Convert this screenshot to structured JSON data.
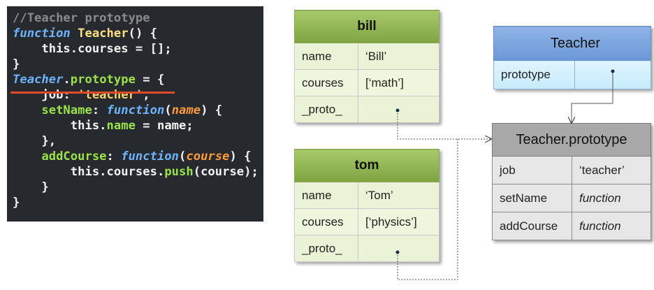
{
  "code": {
    "lines": [
      [
        {
          "t": "//Teacher prototype",
          "c": "cmt"
        }
      ],
      [
        {
          "t": "function",
          "c": "kw"
        },
        {
          "t": " ",
          "c": "plain"
        },
        {
          "t": "Teacher",
          "c": "fn"
        },
        {
          "t": "() {",
          "c": "plain"
        }
      ],
      [
        {
          "t": "    this.",
          "c": "plain"
        },
        {
          "t": "courses",
          "c": "plain"
        },
        {
          "t": " = [];",
          "c": "plain"
        }
      ],
      [
        {
          "t": "}",
          "c": "plain"
        }
      ],
      [
        {
          "t": "Teacher",
          "c": "kw"
        },
        {
          "t": ".",
          "c": "plain"
        },
        {
          "t": "prototype",
          "c": "prop"
        },
        {
          "t": " = {",
          "c": "plain"
        }
      ],
      [
        {
          "t": "    job",
          "c": "plain"
        },
        {
          "t": ": ",
          "c": "plain"
        },
        {
          "t": "'teacher'",
          "c": "str"
        },
        {
          "t": ",",
          "c": "plain"
        }
      ],
      [
        {
          "t": "    setName",
          "c": "prop"
        },
        {
          "t": ": ",
          "c": "plain"
        },
        {
          "t": "function",
          "c": "kw"
        },
        {
          "t": "(",
          "c": "plain"
        },
        {
          "t": "name",
          "c": "param"
        },
        {
          "t": ") {",
          "c": "plain"
        }
      ],
      [
        {
          "t": "        this.",
          "c": "plain"
        },
        {
          "t": "name",
          "c": "prop"
        },
        {
          "t": " = name;",
          "c": "plain"
        }
      ],
      [
        {
          "t": "    },",
          "c": "plain"
        }
      ],
      [
        {
          "t": "    addCourse",
          "c": "prop"
        },
        {
          "t": ": ",
          "c": "plain"
        },
        {
          "t": "function",
          "c": "kw"
        },
        {
          "t": "(",
          "c": "plain"
        },
        {
          "t": "course",
          "c": "param"
        },
        {
          "t": ") {",
          "c": "plain"
        }
      ],
      [
        {
          "t": "        this.courses.",
          "c": "plain"
        },
        {
          "t": "push",
          "c": "prop"
        },
        {
          "t": "(course);",
          "c": "plain"
        }
      ],
      [
        {
          "t": "    }",
          "c": "plain"
        }
      ],
      [
        {
          "t": "}",
          "c": "plain"
        }
      ]
    ]
  },
  "bill": {
    "title": "bill",
    "rows": [
      {
        "key": "name",
        "value": "‘Bill’"
      },
      {
        "key": "courses",
        "value": "[‘math’]"
      },
      {
        "key": "_proto_",
        "value": ""
      }
    ]
  },
  "tom": {
    "title": "tom",
    "rows": [
      {
        "key": "name",
        "value": "‘Tom’"
      },
      {
        "key": "courses",
        "value": "[‘physics’]"
      },
      {
        "key": "_proto_",
        "value": ""
      }
    ]
  },
  "teacher": {
    "title": "Teacher",
    "rows": [
      {
        "key": "prototype",
        "value": ""
      }
    ]
  },
  "teacher_prototype": {
    "title": "Teacher.prototype",
    "rows": [
      {
        "key": "job",
        "value": "‘teacher’"
      },
      {
        "key": "setName",
        "value": "function"
      },
      {
        "key": "addCourse",
        "value": "function"
      }
    ]
  },
  "colors": {
    "code_bg": "#262a2e",
    "object_header": "#8fb04f",
    "object_body": "#eaf3d6",
    "constructor_header": "#7aa3dd",
    "constructor_body": "#cdeefc",
    "prototype_header": "#a8a8a8",
    "prototype_body": "#e6e6e6",
    "underline": "#e24a2a"
  }
}
